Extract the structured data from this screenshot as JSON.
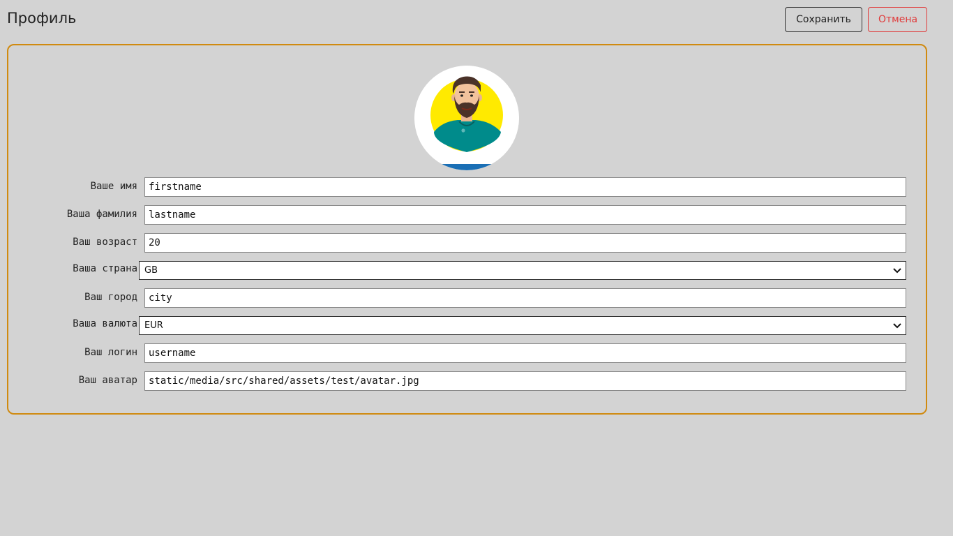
{
  "header": {
    "title": "Профиль",
    "save_label": "Сохранить",
    "cancel_label": "Отмена"
  },
  "colors": {
    "accent_border": "#d08a10",
    "cancel": "#e03a3a",
    "background": "#d3d3d3"
  },
  "form": {
    "firstname": {
      "label": "Ваше имя",
      "value": "firstname"
    },
    "lastname": {
      "label": "Ваша фамилия",
      "value": "lastname"
    },
    "age": {
      "label": "Ваш возраст",
      "value": "20"
    },
    "country": {
      "label": "Ваша страна",
      "value": "GB"
    },
    "city": {
      "label": "Ваш город",
      "value": "city"
    },
    "currency": {
      "label": "Ваша валюта",
      "value": "EUR"
    },
    "username": {
      "label": "Ваш логин",
      "value": "username"
    },
    "avatar": {
      "label": "Ваш аватар",
      "value": "static/media/src/shared/assets/test/avatar.jpg"
    }
  },
  "icons": {
    "avatar": "avatar-image",
    "select_arrow": "chevron-down-icon"
  }
}
